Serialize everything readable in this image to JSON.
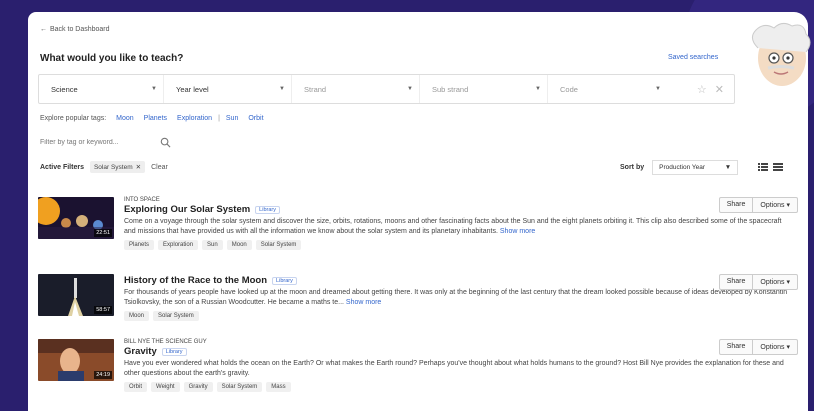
{
  "nav": {
    "back_label": "Back to Dashboard"
  },
  "header": {
    "title": "What would you like to teach?",
    "saved_searches": "Saved searches"
  },
  "filters": {
    "subject": "Science",
    "level": "Year level",
    "strand": "Strand",
    "sub_strand": "Sub strand",
    "code": "Code"
  },
  "popular": {
    "label": "Explore popular tags:",
    "tags": [
      "Moon",
      "Planets",
      "Exploration",
      "Sun",
      "Orbit"
    ]
  },
  "search": {
    "placeholder": "Filter by tag or keyword..."
  },
  "active": {
    "label": "Active Filters",
    "chip": "Solar System",
    "clear": "Clear"
  },
  "sort": {
    "label": "Sort by",
    "value": "Production Year"
  },
  "results": [
    {
      "series": "INTO SPACE",
      "title": "Exploring Our Solar System",
      "badge": "Library",
      "duration": "22:51",
      "description": "Come on a voyage through the solar system and discover the size, orbits, rotations, moons and other fascinating facts about the Sun and the eight planets orbiting it. This clip also described some of the spacecraft and missions that have provided us with all the information we know about the solar system and its planetary inhabitants.",
      "more": "Show more",
      "tags": [
        "Planets",
        "Exploration",
        "Sun",
        "Moon",
        "Solar System"
      ],
      "share": "Share",
      "options": "Options"
    },
    {
      "series": "",
      "title": "History of the Race to the Moon",
      "badge": "Library",
      "duration": "58:57",
      "description": "For thousands of years people have looked up at the moon and dreamed about getting there. It was only at the beginning of the last century that the dream looked possible because of ideas developed by Konstantin Tsiolkovsky, the son of a Russian Woodcutter. He became a maths te...",
      "more": "Show more",
      "tags": [
        "Moon",
        "Solar System"
      ],
      "share": "Share",
      "options": "Options"
    },
    {
      "series": "BILL NYE THE SCIENCE GUY",
      "title": "Gravity",
      "badge": "Library",
      "duration": "24:19",
      "description": "Have you ever wondered what holds the ocean on the Earth? Or what makes the Earth round? Perhaps you've thought about what holds humans to the ground? Host Bill Nye provides the explanation for these and other questions about the earth's gravity.",
      "more": "",
      "tags": [
        "Orbit",
        "Weight",
        "Gravity",
        "Solar System",
        "Mass"
      ],
      "share": "Share",
      "options": "Options"
    }
  ],
  "colors": {
    "background": "#2a1f6e",
    "link": "#3366cc"
  }
}
